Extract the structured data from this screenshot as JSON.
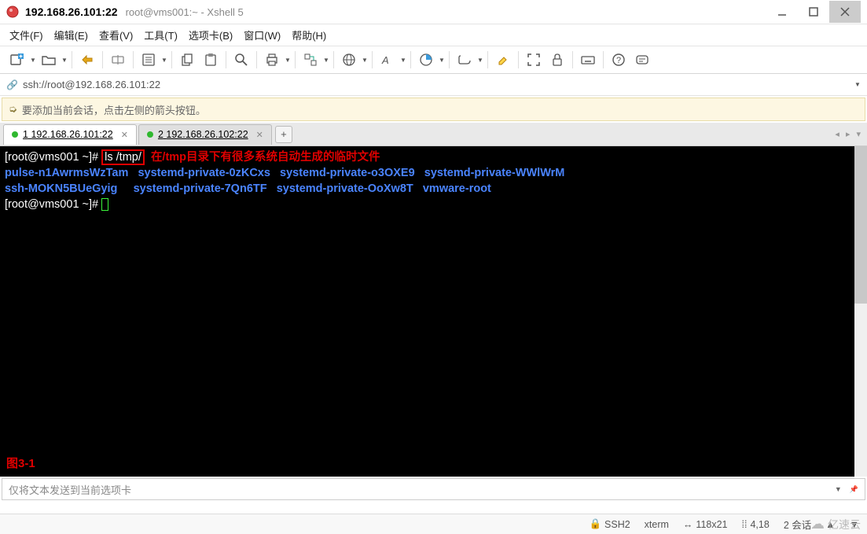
{
  "title": {
    "ip": "192.168.26.101:22",
    "sub": "root@vms001:~ - Xshell 5"
  },
  "menu": {
    "file": "文件(F)",
    "edit": "编辑(E)",
    "view": "查看(V)",
    "tools": "工具(T)",
    "tab": "选项卡(B)",
    "window": "窗口(W)",
    "help": "帮助(H)"
  },
  "address": {
    "url": "ssh://root@192.168.26.101:22"
  },
  "tip": {
    "text": "要添加当前会话，点击左侧的箭头按钮。"
  },
  "tabs": {
    "items": [
      {
        "num": "1",
        "label": "192.168.26.101:22",
        "active": true
      },
      {
        "num": "2",
        "label": "192.168.26.102:22",
        "active": false
      }
    ],
    "nav_prev": "◂",
    "nav_next": "▸",
    "nav_menu": "▾"
  },
  "terminal": {
    "prompt1": "[root@vms001 ~]#",
    "command": "ls /tmp/",
    "annotation": "在/tmp目录下有很多系统自动生成的临时文件",
    "row1": {
      "c1": "pulse-n1AwrmsWzTam",
      "c2": "systemd-private-0zKCxs",
      "c3": "systemd-private-o3OXE9",
      "c4": "systemd-private-WWlWrM"
    },
    "row2": {
      "c1": "ssh-MOKN5BUeGyig",
      "c2": "systemd-private-7Qn6TF",
      "c3": "systemd-private-OoXw8T",
      "c4": "vmware-root"
    },
    "prompt2": "[root@vms001 ~]#",
    "figure_label": "图3-1"
  },
  "input_bar": {
    "placeholder": "仅将文本发送到当前选项卡"
  },
  "status": {
    "proto": "SSH2",
    "term": "xterm",
    "size": "118x21",
    "pos": "4,18",
    "sessions": "2 会话"
  },
  "watermark": {
    "text": "亿速云"
  }
}
